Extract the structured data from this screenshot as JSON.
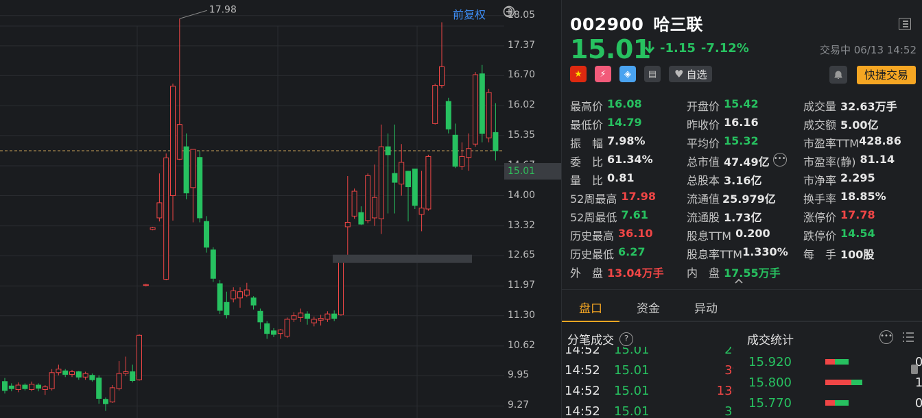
{
  "chart": {
    "fuquan_label": "前复权",
    "y_ticks": [
      "18.05",
      "17.37",
      "16.70",
      "16.02",
      "15.35",
      "14.67",
      "14.00",
      "13.32",
      "12.65",
      "11.97",
      "11.30",
      "10.62",
      "9.95",
      "9.27"
    ],
    "current_price_tag": "15.01",
    "high_annotation": "17.98",
    "colors": {
      "up": "#f04646",
      "down": "#27c160"
    }
  },
  "chart_data": {
    "type": "candlestick",
    "ylim": [
      9.0,
      18.4
    ],
    "candles": [
      {
        "o": 9.82,
        "c": 9.62,
        "h": 9.9,
        "l": 9.55
      },
      {
        "o": 9.72,
        "c": 9.66,
        "h": 9.78,
        "l": 9.6
      },
      {
        "o": 9.64,
        "c": 9.74,
        "h": 9.8,
        "l": 9.58
      },
      {
        "o": 9.74,
        "c": 9.66,
        "h": 9.78,
        "l": 9.62
      },
      {
        "o": 9.64,
        "c": 9.76,
        "h": 9.82,
        "l": 9.6
      },
      {
        "o": 9.74,
        "c": 9.67,
        "h": 9.78,
        "l": 9.6
      },
      {
        "o": 9.64,
        "c": 9.7,
        "h": 9.74,
        "l": 9.52
      },
      {
        "o": 9.66,
        "c": 10.02,
        "h": 10.1,
        "l": 9.62
      },
      {
        "o": 10.02,
        "c": 10.1,
        "h": 10.2,
        "l": 9.96
      },
      {
        "o": 10.06,
        "c": 9.98,
        "h": 10.1,
        "l": 9.92
      },
      {
        "o": 9.98,
        "c": 10.04,
        "h": 10.08,
        "l": 9.92
      },
      {
        "o": 10.04,
        "c": 9.92,
        "h": 10.06,
        "l": 9.86
      },
      {
        "o": 9.92,
        "c": 10.0,
        "h": 10.04,
        "l": 9.86
      },
      {
        "o": 9.96,
        "c": 9.86,
        "h": 10.0,
        "l": 9.82
      },
      {
        "o": 9.9,
        "c": 9.44,
        "h": 9.96,
        "l": 9.32
      },
      {
        "o": 9.42,
        "c": 9.32,
        "h": 9.46,
        "l": 9.16
      },
      {
        "o": 9.36,
        "c": 9.68,
        "h": 9.74,
        "l": 9.34
      },
      {
        "o": 9.66,
        "c": 10.0,
        "h": 10.28,
        "l": 9.62
      },
      {
        "o": 10.0,
        "c": 10.04,
        "h": 10.38,
        "l": 9.94
      },
      {
        "o": 10.04,
        "c": 9.84,
        "h": 10.2,
        "l": 9.8
      },
      {
        "o": 9.86,
        "c": 10.86,
        "h": 10.88,
        "l": 9.84
      },
      {
        "o": 11.98,
        "c": 12.0,
        "h": 12.02,
        "l": 11.96
      },
      {
        "o": 13.24,
        "c": 13.28,
        "h": 13.3,
        "l": 13.22
      },
      {
        "o": 13.5,
        "c": 13.84,
        "h": 14.5,
        "l": 13.42
      },
      {
        "o": 12.12,
        "c": 14.85,
        "h": 14.95,
        "l": 12.1
      },
      {
        "o": 14.0,
        "c": 16.46,
        "h": 16.52,
        "l": 13.44
      },
      {
        "o": 14.82,
        "c": 15.6,
        "h": 17.98,
        "l": 14.8
      },
      {
        "o": 15.1,
        "c": 14.06,
        "h": 15.4,
        "l": 13.92
      },
      {
        "o": 14.18,
        "c": 15.04,
        "h": 15.04,
        "l": 13.4
      },
      {
        "o": 14.86,
        "c": 13.5,
        "h": 15.0,
        "l": 13.4
      },
      {
        "o": 13.42,
        "c": 12.84,
        "h": 13.54,
        "l": 12.72
      },
      {
        "o": 12.78,
        "c": 12.14,
        "h": 12.84,
        "l": 12.06
      },
      {
        "o": 12.02,
        "c": 11.42,
        "h": 12.1,
        "l": 11.34
      },
      {
        "o": 11.6,
        "c": 11.32,
        "h": 11.84,
        "l": 11.24
      },
      {
        "o": 11.68,
        "c": 11.86,
        "h": 11.94,
        "l": 11.6
      },
      {
        "o": 11.7,
        "c": 11.84,
        "h": 11.94,
        "l": 11.48
      },
      {
        "o": 11.76,
        "c": 11.88,
        "h": 12.04,
        "l": 11.72
      },
      {
        "o": 11.7,
        "c": 11.54,
        "h": 11.74,
        "l": 11.44
      },
      {
        "o": 11.4,
        "c": 11.16,
        "h": 11.46,
        "l": 11.0
      },
      {
        "o": 11.12,
        "c": 10.9,
        "h": 11.18,
        "l": 10.78
      },
      {
        "o": 10.96,
        "c": 10.88,
        "h": 11.02,
        "l": 10.82
      },
      {
        "o": 10.9,
        "c": 10.98,
        "h": 11.0,
        "l": 10.78
      },
      {
        "o": 10.84,
        "c": 11.22,
        "h": 11.26,
        "l": 10.8
      },
      {
        "o": 11.22,
        "c": 11.3,
        "h": 11.38,
        "l": 11.16
      },
      {
        "o": 11.26,
        "c": 11.36,
        "h": 11.46,
        "l": 11.16
      },
      {
        "o": 11.34,
        "c": 11.24,
        "h": 11.4,
        "l": 11.1
      },
      {
        "o": 11.14,
        "c": 11.22,
        "h": 11.28,
        "l": 11.06
      },
      {
        "o": 11.2,
        "c": 11.24,
        "h": 11.32,
        "l": 11.08
      },
      {
        "o": 11.22,
        "c": 11.34,
        "h": 11.4,
        "l": 11.16
      },
      {
        "o": 11.34,
        "c": 11.24,
        "h": 11.42,
        "l": 11.18
      },
      {
        "o": 11.32,
        "c": 12.5,
        "h": 12.52,
        "l": 11.3
      },
      {
        "o": 13.3,
        "c": 13.4,
        "h": 14.44,
        "l": 12.64
      },
      {
        "o": 13.54,
        "c": 14.1,
        "h": 14.16,
        "l": 13.48
      },
      {
        "o": 13.62,
        "c": 13.36,
        "h": 13.76,
        "l": 13.34
      },
      {
        "o": 13.44,
        "c": 14.45,
        "h": 14.5,
        "l": 13.38
      },
      {
        "o": 13.5,
        "c": 13.96,
        "h": 14.7,
        "l": 13.32
      },
      {
        "o": 13.48,
        "c": 15.1,
        "h": 15.6,
        "l": 13.14
      },
      {
        "o": 15.1,
        "c": 14.92,
        "h": 15.4,
        "l": 13.6
      },
      {
        "o": 14.5,
        "c": 14.3,
        "h": 15.6,
        "l": 13.6
      },
      {
        "o": 14.26,
        "c": 14.75,
        "h": 15.16,
        "l": 14.0
      },
      {
        "o": 14.55,
        "c": 14.2,
        "h": 14.56,
        "l": 13.42
      },
      {
        "o": 14.6,
        "c": 13.78,
        "h": 14.2,
        "l": 13.7
      },
      {
        "o": 13.58,
        "c": 13.72,
        "h": 14.56,
        "l": 13.2
      },
      {
        "o": 13.7,
        "c": 14.88,
        "h": 14.92,
        "l": 13.66
      },
      {
        "o": 15.62,
        "c": 16.48,
        "h": 16.52,
        "l": 15.6
      },
      {
        "o": 16.48,
        "c": 16.9,
        "h": 17.9,
        "l": 16.42
      },
      {
        "o": 16.12,
        "c": 15.5,
        "h": 16.2,
        "l": 15.4
      },
      {
        "o": 15.36,
        "c": 14.66,
        "h": 15.62,
        "l": 14.62
      },
      {
        "o": 14.66,
        "c": 14.88,
        "h": 15.2,
        "l": 14.58
      },
      {
        "o": 14.86,
        "c": 15.06,
        "h": 15.4,
        "l": 14.56
      },
      {
        "o": 15.16,
        "c": 16.72,
        "h": 16.78,
        "l": 15.1
      },
      {
        "o": 16.74,
        "c": 15.4,
        "h": 16.94,
        "l": 15.2
      },
      {
        "o": 15.3,
        "c": 16.32,
        "h": 16.4,
        "l": 15.2
      },
      {
        "o": 15.42,
        "c": 15.01,
        "h": 16.08,
        "l": 14.79
      }
    ]
  },
  "stock": {
    "code": "002900",
    "name": "哈三联",
    "price": "15.01",
    "change": "-1.15",
    "change_pct": "-7.12%",
    "status": "交易中 06/13 14:52"
  },
  "actions": {
    "watch_label": "自选",
    "quick_trade_label": "快捷交易"
  },
  "stats": [
    [
      {
        "k": "最高价",
        "v": "16.08",
        "c": "green"
      },
      {
        "k": "开盘价",
        "v": "15.42",
        "c": "green"
      },
      {
        "k": "成交量",
        "v": "32.63万手",
        "c": "white"
      }
    ],
    [
      {
        "k": "最低价",
        "v": "14.79",
        "c": "green"
      },
      {
        "k": "昨收价",
        "v": "16.16",
        "c": "white"
      },
      {
        "k": "成交额",
        "v": "5.00亿",
        "c": "white"
      }
    ],
    [
      {
        "k": "振　幅",
        "v": "7.98%",
        "c": "white"
      },
      {
        "k": "平均价",
        "v": "15.32",
        "c": "green"
      },
      {
        "k": "市盈率TTM",
        "v": "428.86",
        "c": "white"
      }
    ],
    [
      {
        "k": "委　比",
        "v": "61.34%",
        "c": "white"
      },
      {
        "k": "总市值",
        "v": "47.49亿",
        "c": "white"
      },
      {
        "k": "市盈率(静)",
        "v": "81.14",
        "c": "white"
      }
    ],
    [
      {
        "k": "量　比",
        "v": "0.81",
        "c": "white"
      },
      {
        "k": "总股本",
        "v": "3.16亿",
        "c": "white"
      },
      {
        "k": "市净率",
        "v": "2.295",
        "c": "white"
      }
    ],
    [
      {
        "k": "52周最高",
        "v": "17.98",
        "c": "red"
      },
      {
        "k": "流通值",
        "v": "25.979亿",
        "c": "white"
      },
      {
        "k": "换手率",
        "v": "18.85%",
        "c": "white"
      }
    ],
    [
      {
        "k": "52周最低",
        "v": "7.61",
        "c": "green"
      },
      {
        "k": "流通股",
        "v": "1.73亿",
        "c": "white"
      },
      {
        "k": "涨停价",
        "v": "17.78",
        "c": "red"
      }
    ],
    [
      {
        "k": "历史最高",
        "v": "36.10",
        "c": "red"
      },
      {
        "k": "股息TTM",
        "v": "0.200",
        "c": "white"
      },
      {
        "k": "跌停价",
        "v": "14.54",
        "c": "green"
      }
    ],
    [
      {
        "k": "历史最低",
        "v": "6.27",
        "c": "green"
      },
      {
        "k": "股息率TTM",
        "v": "1.330%",
        "c": "white"
      },
      {
        "k": "每　手",
        "v": "100股",
        "c": "white"
      }
    ],
    [
      {
        "k": "外　盘",
        "v": "13.04万手",
        "c": "red"
      },
      {
        "k": "内　盘",
        "v": "17.55万手",
        "c": "green"
      },
      {
        "k": "",
        "v": "",
        "c": "white"
      }
    ]
  ],
  "tabs": [
    "盘口",
    "资金",
    "异动"
  ],
  "ticks_panel": {
    "title": "分笔成交",
    "rows": [
      {
        "t": "14:52",
        "p": "15.01",
        "vol": "26",
        "dir": "down"
      },
      {
        "t": "14:52",
        "p": "15.01",
        "vol": "39",
        "dir": "up"
      },
      {
        "t": "14:52",
        "p": "15.01",
        "vol": "130",
        "dir": "up"
      },
      {
        "t": "14:52",
        "p": "15.01",
        "vol": "31",
        "dir": "down"
      }
    ]
  },
  "dist_panel": {
    "title": "成交统计",
    "rows": [
      {
        "p": "15.920",
        "pct": "0.96%",
        "red": 0.4,
        "green": 0.6
      },
      {
        "p": "15.800",
        "pct": "1.54%",
        "red": 0.7,
        "green": 0.3
      },
      {
        "p": "15.770",
        "pct": "0.88%",
        "red": 0.4,
        "green": 0.6
      }
    ]
  }
}
